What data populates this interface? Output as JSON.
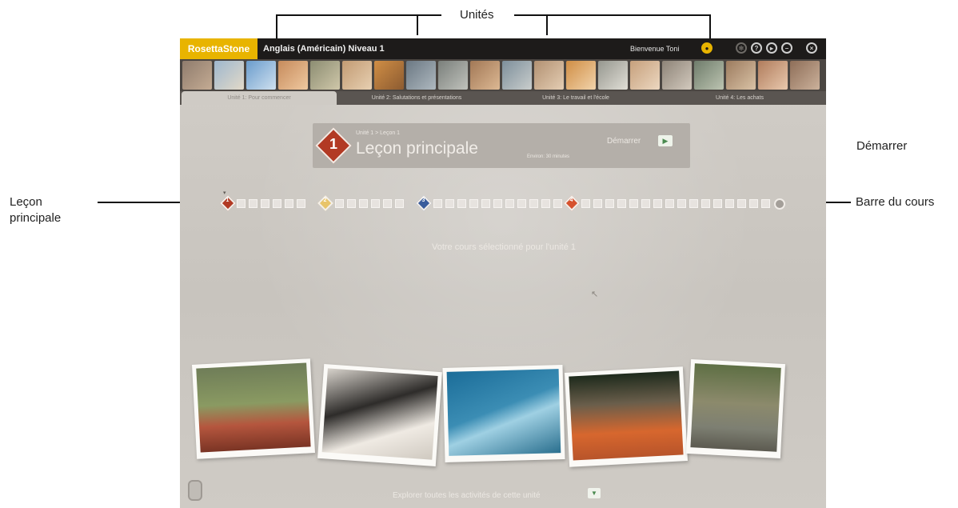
{
  "callouts": {
    "unites": "Unités",
    "demarrer": "Démarrer",
    "lecon_principale_line1": "Leçon",
    "lecon_principale_line2": "principale",
    "barre_du_cours": "Barre du cours"
  },
  "app": {
    "logo": "RosettaStone",
    "course_title": "Anglais (Américain) Niveau 1",
    "welcome": "Bienvenue  Toni",
    "toolbar_icons": [
      "user-icon",
      "settings-icon",
      "help-icon",
      "exit-icon",
      "minimize-icon",
      "close-icon"
    ]
  },
  "unit_tabs": [
    {
      "label": "Unité 1: Pour commencer",
      "active": true
    },
    {
      "label": "Unité 2: Salutations et présentations",
      "active": false
    },
    {
      "label": "Unité 3: Le travail et l'école",
      "active": false
    },
    {
      "label": "Unité 4: Les achats",
      "active": false
    }
  ],
  "lesson_card": {
    "subtitle": "Unité 1 > Leçon 1",
    "number": "1",
    "title": "Leçon principale",
    "duration": "Environ: 30 minutes",
    "start_label": "Démarrer",
    "start_icon": "play-icon"
  },
  "course_bar": {
    "milestones": [
      "1",
      "2",
      "3",
      "4"
    ],
    "arrow": "▾"
  },
  "unit_selected_text": "Votre cours sélectionné pour l'unité 1",
  "explore_text": "Explorer toutes les activités de cette unité",
  "colors": {
    "accent_logo": "#e8b400",
    "lesson_red": "#b23a24",
    "milestone_yellow": "#e8c46a",
    "milestone_blue": "#3a5d9c",
    "milestone_orange": "#d6522e",
    "app_background": "#c9c5bf"
  }
}
